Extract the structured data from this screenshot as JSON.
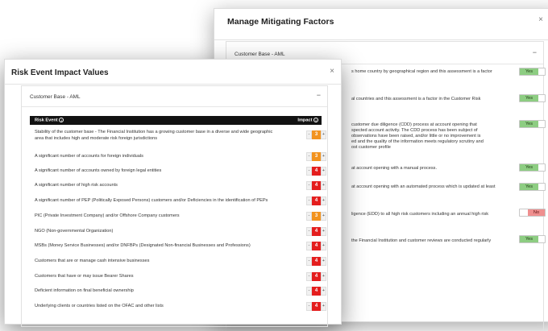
{
  "back_modal": {
    "title": "Manage Mitigating Factors",
    "close_label": "×",
    "panel_title": "Customer Base - AML",
    "collapse_label": "−",
    "factors": [
      {
        "lines": [
          "s home country by geographical region and this assessment is a factor"
        ],
        "toggle": "Yes",
        "state": "yes"
      },
      {
        "lines": [
          "al countries and this assessment is a factor in the Customer Risk"
        ],
        "toggle": "Yes",
        "state": "yes"
      },
      {
        "lines": [
          "customer due diligence (CDD) process at account opening that",
          "spected account activity. The CDD process has been subject of",
          "observations have been raised, and/or little or no improvement is",
          "ed and the quality of the information meets regulatory scrutiny and",
          "ost customer profile"
        ],
        "toggle": "Yes",
        "state": "yes"
      },
      {
        "lines": [
          "at account opening with a manual process."
        ],
        "toggle": "Yes",
        "state": "yes"
      },
      {
        "lines": [
          "at account opening with an automated process which is updated at least"
        ],
        "toggle": "Yes",
        "state": "yes"
      },
      {
        "lines": [
          "ligence (EDD) to all high risk customers including an annual high risk"
        ],
        "toggle": "No",
        "state": "no"
      },
      {
        "lines": [
          "the Financial Institution and customer reviews are conducted regularly"
        ],
        "toggle": "Yes",
        "state": "yes"
      }
    ]
  },
  "front_modal": {
    "title": "Risk Event Impact Values",
    "close_label": "×",
    "panel_title": "Customer Base - AML",
    "collapse_label": "−",
    "table": {
      "col_event": "Risk Event",
      "col_impact": "Impact",
      "info_icon": "i",
      "minus": "-",
      "plus": "+",
      "rows": [
        {
          "text": "Stability of the customer base - The Financial Institution has a growing customer base in a diverse and wide geographic area that includes high and moderate risk foreign jurisdictions",
          "impact": "3",
          "color": "orange"
        },
        {
          "text": "A significant number of accounts for foreign individuals",
          "impact": "3",
          "color": "orange"
        },
        {
          "text": "A significant number of accounts owned by foreign legal entities",
          "impact": "4",
          "color": "red"
        },
        {
          "text": "A significant number of high risk accounts",
          "impact": "4",
          "color": "red"
        },
        {
          "text": "A significant number of PEP (Politically Exposed Persons) customers and/or Deficiencies in the identification of PEPs",
          "impact": "4",
          "color": "red"
        },
        {
          "text": "PIC (Private Investment Company) and/or Offshore Company customers",
          "impact": "3",
          "color": "orange"
        },
        {
          "text": "NGO (Non-governmental Organization)",
          "impact": "4",
          "color": "red"
        },
        {
          "text": "MSBs (Money Service Businesses) and/or DNFBPs (Designated Non-financial Businesses and Professions)",
          "impact": "4",
          "color": "red"
        },
        {
          "text": "Customers that are or manage cash intensive businesses",
          "impact": "4",
          "color": "red"
        },
        {
          "text": "Customers that have or may issue Bearer Shares",
          "impact": "4",
          "color": "red"
        },
        {
          "text": "Deficient information on final beneficial ownership",
          "impact": "4",
          "color": "red"
        },
        {
          "text": "Underlying clients or countries listed on the OFAC and other lists",
          "impact": "4",
          "color": "red"
        }
      ]
    }
  },
  "colors": {
    "yes": "#8dcd82",
    "no": "#ef8f8f",
    "impact_red": "#e41e1e",
    "impact_orange": "#f2931f",
    "table_header": "#121212"
  }
}
